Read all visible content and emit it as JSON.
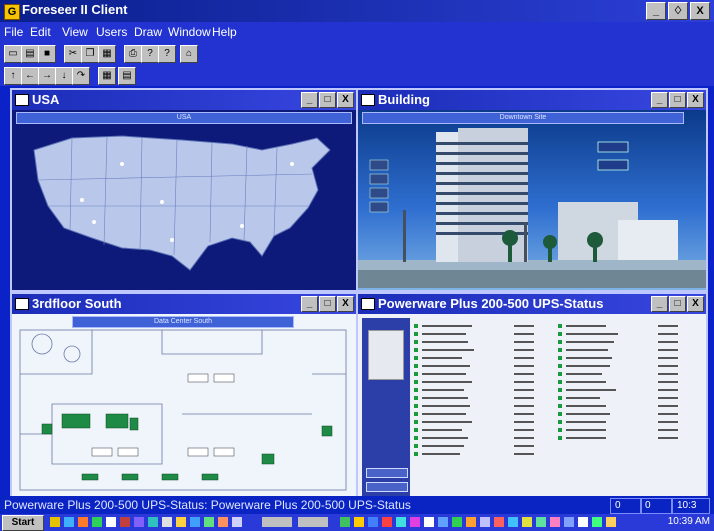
{
  "app": {
    "title": "Foreseer II Client",
    "window_controls": [
      "_",
      "♢",
      "X"
    ]
  },
  "menu": [
    "File",
    "Edit",
    "View",
    "Users",
    "Draw",
    "Window",
    "Help"
  ],
  "windows": {
    "usa": {
      "title": "USA",
      "banner": "USA"
    },
    "building": {
      "title": "Building",
      "banner": "Downtown Site"
    },
    "floor": {
      "title": "3rdfloor South",
      "banner": "Data Center South"
    },
    "ups": {
      "title": "Powerware Plus 200-500 UPS-Status"
    }
  },
  "status": {
    "text": "Powerware Plus 200-500 UPS-Status: Powerware Plus 200-500 UPS-Status",
    "field1": "0",
    "field2": "0",
    "field3": "10:3"
  },
  "taskbar": {
    "start": "Start",
    "clock": "10:39 AM"
  },
  "colors": {
    "accent": "#0b22c8",
    "titlebar": "#1b2db8",
    "status_green": "#1a9a3a"
  }
}
